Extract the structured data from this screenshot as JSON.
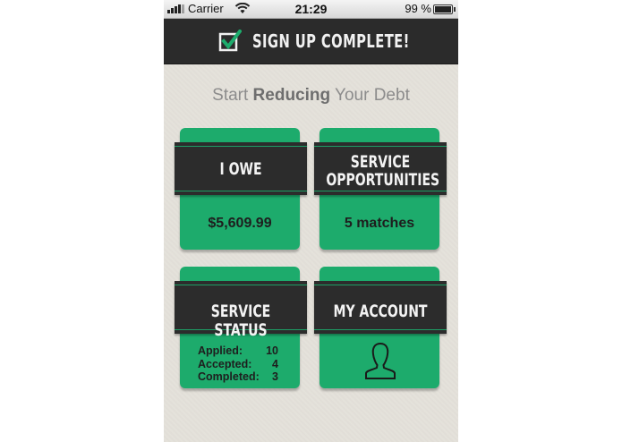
{
  "status_bar": {
    "carrier": "Carrier",
    "time": "21:29",
    "battery_percent": "99 %",
    "battery_level": 0.99
  },
  "header": {
    "title": "SIGN UP COMPLETE!",
    "icon": "checkbox-checked-icon"
  },
  "subtitle": {
    "before": "Start ",
    "bold": "Reducing",
    "after": " Your Debt"
  },
  "tiles": {
    "owe": {
      "label": "I OWE",
      "value": "$5,609.99"
    },
    "opportunities": {
      "label_line1": "SERVICE",
      "label_line2": "OPPORTUNITIES",
      "value": "5 matches"
    },
    "status": {
      "label": "SERVICE STATUS",
      "rows": [
        {
          "key": "Applied:",
          "value": "10"
        },
        {
          "key": "Accepted:",
          "value": "4"
        },
        {
          "key": "Completed:",
          "value": "3"
        }
      ]
    },
    "account": {
      "label": "MY ACCOUNT",
      "icon": "person-silhouette-icon"
    }
  },
  "colors": {
    "accent_green": "#1dab6c",
    "dark_band": "#2c2c2c",
    "background": "#e4e1da"
  }
}
